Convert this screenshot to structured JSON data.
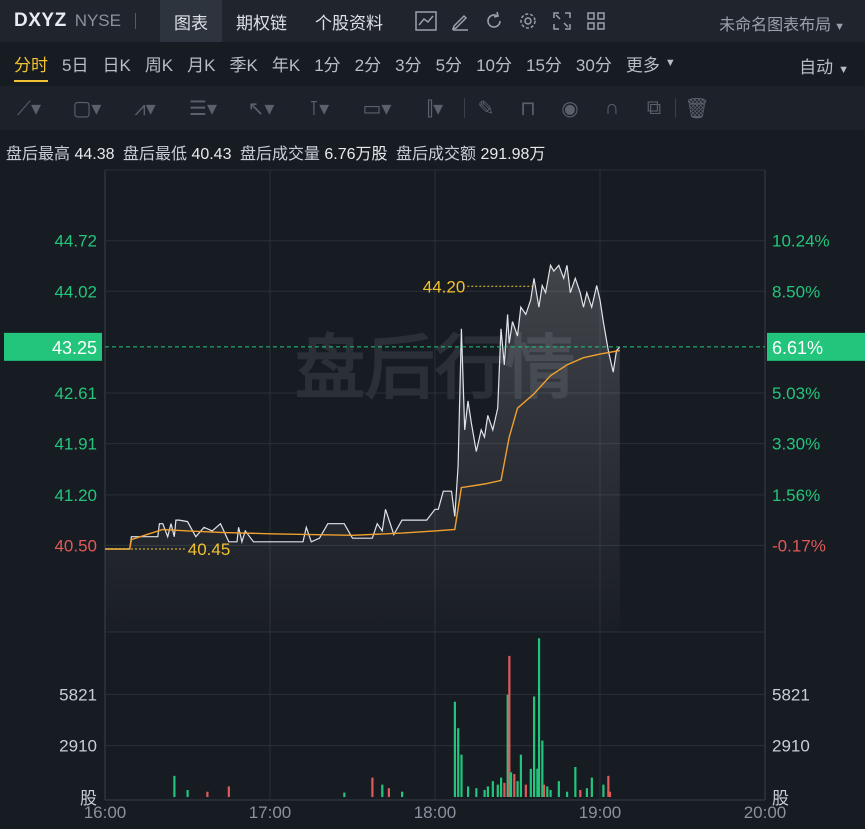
{
  "header": {
    "ticker": "DXYZ",
    "exchange": "NYSE",
    "tabs": [
      {
        "label": "图表",
        "active": true
      },
      {
        "label": "期权链",
        "active": false
      },
      {
        "label": "个股资料",
        "active": false
      }
    ],
    "tools": [
      "line-chart-icon",
      "edit-icon",
      "refresh-icon",
      "gear-icon",
      "fullscreen-icon",
      "grid-icon"
    ],
    "layout_label": "未命名图表布局"
  },
  "periods": {
    "items": [
      "分时",
      "5日",
      "日K",
      "周K",
      "月K",
      "季K",
      "年K",
      "1分",
      "2分",
      "3分",
      "5分",
      "10分",
      "15分",
      "30分",
      "更多"
    ],
    "active": "分时",
    "scale_mode": "自动"
  },
  "draw_tools": [
    "trend-line-icon",
    "rectangle-icon",
    "wave-icon",
    "fib-icon",
    "arrow-icon",
    "vertical-line-icon",
    "text-icon",
    "measure-icon",
    "pencil-icon",
    "lock-icon",
    "eye-icon",
    "magnet-icon",
    "layers-icon",
    "trash-icon"
  ],
  "stats": {
    "high_label": "盘后最高",
    "high_value": "44.38",
    "low_label": "盘后最低",
    "low_value": "40.43",
    "volume_label": "盘后成交量",
    "volume_value": "6.76万股",
    "amount_label": "盘后成交额",
    "amount_value": "291.98万"
  },
  "watermark": "盘后行情",
  "colors": {
    "up": "#22c57b",
    "down": "#e05a5a",
    "accent": "#f2c230",
    "avg_line": "#f0a030",
    "price_line": "#e0e4ea"
  },
  "chart_data": {
    "type": "line",
    "x_ticks": [
      "16:00",
      "17:00",
      "18:00",
      "19:00",
      "20:00"
    ],
    "x_range": [
      16.0,
      20.0
    ],
    "y_ticks_left": [
      "44.72",
      "44.02",
      "42.61",
      "41.91",
      "41.20",
      "40.50"
    ],
    "y_ticks_right": [
      "10.24%",
      "8.50%",
      "5.03%",
      "3.30%",
      "1.56%",
      "-0.17%"
    ],
    "y_range": [
      39.3,
      45.7
    ],
    "current_price": "43.25",
    "current_pct": "6.61%",
    "current_value": 43.25,
    "high_annotation": {
      "label": "44.20",
      "time": 18.62,
      "value": 44.2
    },
    "low_annotation": {
      "label": "40.45",
      "time": 16.15,
      "value": 40.45
    },
    "price": {
      "times": [
        16.0,
        16.12,
        16.15,
        16.16,
        16.2,
        16.25,
        16.32,
        16.33,
        16.35,
        16.38,
        16.4,
        16.42,
        16.43,
        16.45,
        16.5,
        16.55,
        16.6,
        16.65,
        16.7,
        16.75,
        16.8,
        16.81,
        16.83,
        16.85,
        16.9,
        17.0,
        17.05,
        17.1,
        17.15,
        17.18,
        17.2,
        17.22,
        17.25,
        17.3,
        17.35,
        17.4,
        17.45,
        17.5,
        17.55,
        17.6,
        17.62,
        17.65,
        17.68,
        17.7,
        17.75,
        17.8,
        17.85,
        17.9,
        17.95,
        18.0,
        18.02,
        18.05,
        18.1,
        18.12,
        18.14,
        18.16,
        18.18,
        18.2,
        18.22,
        18.25,
        18.28,
        18.3,
        18.32,
        18.35,
        18.38,
        18.4,
        18.42,
        18.44,
        18.45,
        18.47,
        18.5,
        18.52,
        18.55,
        18.58,
        18.6,
        18.63,
        18.65,
        18.67,
        18.7,
        18.72,
        18.75,
        18.78,
        18.8,
        18.82,
        18.85,
        18.88,
        18.9,
        18.92,
        18.95,
        18.98,
        19.0,
        19.02,
        19.05,
        19.08,
        19.1,
        19.12
      ],
      "values": [
        40.45,
        40.45,
        40.45,
        40.62,
        40.62,
        40.62,
        40.62,
        40.8,
        40.8,
        40.62,
        40.8,
        40.62,
        40.85,
        40.85,
        40.83,
        40.62,
        40.75,
        40.7,
        40.8,
        40.55,
        40.55,
        40.75,
        40.55,
        40.7,
        40.55,
        40.55,
        40.55,
        40.55,
        40.55,
        40.55,
        40.55,
        40.75,
        40.55,
        40.6,
        40.8,
        40.8,
        40.8,
        40.6,
        40.6,
        40.6,
        40.6,
        40.8,
        40.7,
        41.0,
        40.65,
        40.85,
        40.85,
        40.85,
        40.85,
        41.0,
        41.0,
        41.25,
        41.25,
        40.9,
        41.6,
        43.5,
        42.1,
        42.5,
        42.2,
        41.8,
        42.1,
        42.0,
        42.3,
        42.1,
        42.4,
        43.5,
        43.0,
        43.7,
        43.3,
        43.6,
        43.4,
        43.8,
        43.7,
        43.9,
        44.2,
        43.8,
        44.1,
        44.0,
        44.38,
        44.3,
        44.38,
        44.2,
        44.38,
        44.0,
        44.2,
        44.0,
        43.8,
        44.0,
        43.8,
        44.1,
        43.9,
        43.6,
        43.2,
        42.9,
        43.2,
        43.25
      ]
    },
    "avg": {
      "times": [
        16.0,
        16.15,
        16.16,
        16.35,
        16.5,
        16.7,
        17.0,
        17.5,
        17.8,
        18.0,
        18.12,
        18.16,
        18.3,
        18.4,
        18.45,
        18.5,
        18.6,
        18.7,
        18.8,
        18.9,
        19.0,
        19.12
      ],
      "values": [
        40.45,
        40.45,
        40.58,
        40.72,
        40.7,
        40.68,
        40.66,
        40.64,
        40.67,
        40.7,
        40.72,
        41.3,
        41.35,
        41.4,
        42.0,
        42.4,
        42.6,
        42.85,
        43.0,
        43.1,
        43.15,
        43.2
      ]
    },
    "volume": {
      "y_ticks": [
        "5821",
        "2910"
      ],
      "y_range": [
        0,
        8900
      ],
      "unit_label": "股",
      "times": [
        16.42,
        16.5,
        16.62,
        16.75,
        17.45,
        17.62,
        17.68,
        17.72,
        17.8,
        18.12,
        18.14,
        18.16,
        18.2,
        18.25,
        18.3,
        18.32,
        18.35,
        18.38,
        18.4,
        18.42,
        18.44,
        18.45,
        18.46,
        18.48,
        18.5,
        18.52,
        18.55,
        18.58,
        18.6,
        18.62,
        18.63,
        18.65,
        18.66,
        18.68,
        18.7,
        18.75,
        18.8,
        18.85,
        18.88,
        18.92,
        18.95,
        19.02,
        19.05,
        19.06
      ],
      "values": [
        1200,
        400,
        300,
        600,
        250,
        1100,
        700,
        500,
        300,
        5400,
        3900,
        2400,
        600,
        500,
        400,
        600,
        900,
        700,
        1100,
        800,
        5800,
        8000,
        1400,
        1300,
        900,
        2400,
        700,
        1600,
        5700,
        1600,
        9000,
        3200,
        700,
        600,
        400,
        900,
        300,
        1700,
        400,
        500,
        1100,
        700,
        1200,
        300
      ],
      "directions": [
        "up",
        "up",
        "down",
        "down",
        "up",
        "down",
        "up",
        "down",
        "up",
        "up",
        "up",
        "up",
        "up",
        "up",
        "up",
        "up",
        "up",
        "up",
        "up",
        "down",
        "up",
        "down",
        "up",
        "down",
        "up",
        "up",
        "down",
        "up",
        "up",
        "up",
        "up",
        "up",
        "down",
        "up",
        "up",
        "up",
        "up",
        "up",
        "down",
        "up",
        "up",
        "up",
        "down",
        "down"
      ]
    }
  }
}
